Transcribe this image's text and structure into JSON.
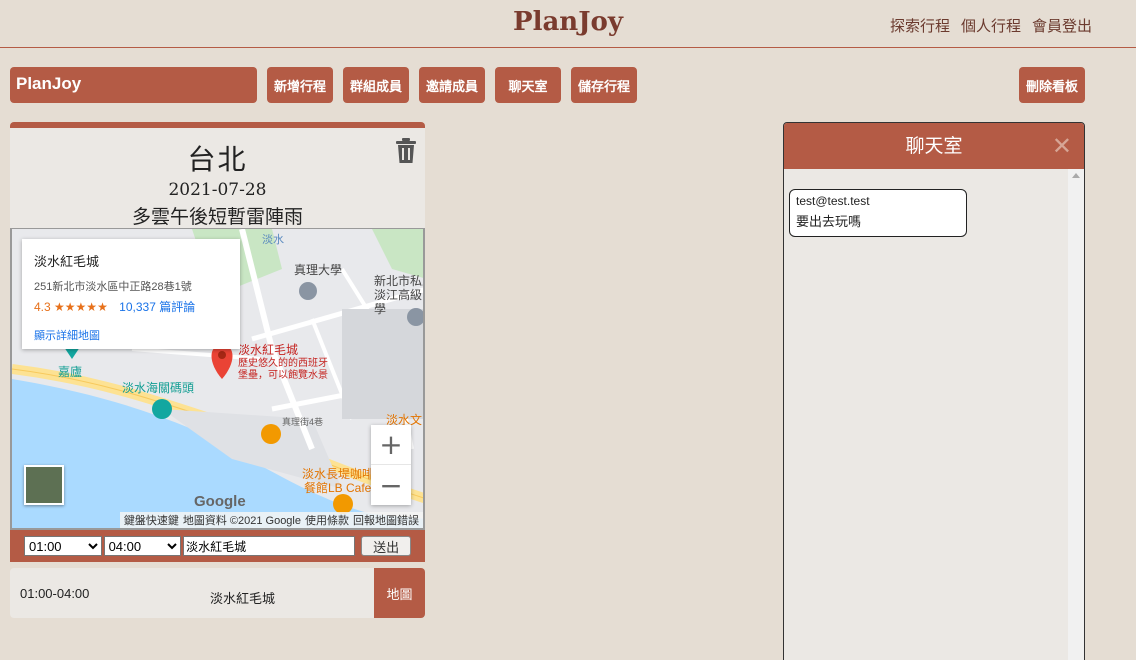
{
  "header": {
    "brand": "PlanJoy",
    "nav": [
      "探索行程",
      "個人行程",
      "會員登出"
    ]
  },
  "toolbar": {
    "board_title": "PlanJoy",
    "buttons": [
      "新增行程",
      "群組成員",
      "邀請成員",
      "聊天室",
      "儲存行程"
    ],
    "delete_board": "刪除看板"
  },
  "card": {
    "city": "台北",
    "date": "2021-07-28",
    "weather": "多雲午後短暫雷陣雨",
    "trash_icon": "trash-icon",
    "map": {
      "info_title": "淡水紅毛城",
      "info_address": "251新北市淡水區中正路28巷1號",
      "info_rating": "4.3",
      "info_stars": "★★★★★",
      "info_reviews": "10,337 篇評論",
      "info_link": "顯示詳細地圖",
      "labels": {
        "university": "真理大學",
        "school": "新北市私立淡江高級中學",
        "fort": "淡水紅毛城",
        "fort_desc1": "歷史悠久的的西班牙",
        "fort_desc2": "堡壘，可以飽覽水景",
        "pier": "淡水海關碼頭",
        "jialu": "嘉廬",
        "street": "真理街4巷",
        "cafe1": "淡水長堤咖啡",
        "cafe2": "餐館LB Cafe",
        "culture": "淡水文",
        "river": "淡水"
      },
      "zoom_in": "+",
      "zoom_out": "−",
      "google": "Google",
      "footer": [
        "鍵盤快速鍵",
        "地圖資料 ©2021 Google",
        "使用條款",
        "回報地圖錯誤"
      ]
    },
    "form": {
      "start": "01:00",
      "end": "04:00",
      "place": "淡水紅毛城",
      "send": "送出"
    },
    "item": {
      "time": "01:00-04:00",
      "place": "淡水紅毛城",
      "map_btn": "地圖"
    }
  },
  "chat": {
    "title": "聊天室",
    "close": "✕",
    "messages": [
      {
        "from": "test@test.test",
        "text": "要出去玩嗎"
      }
    ]
  },
  "colors": {
    "accent": "#b45b45",
    "background": "#e5ddd3",
    "panel": "#ebe8e4"
  }
}
